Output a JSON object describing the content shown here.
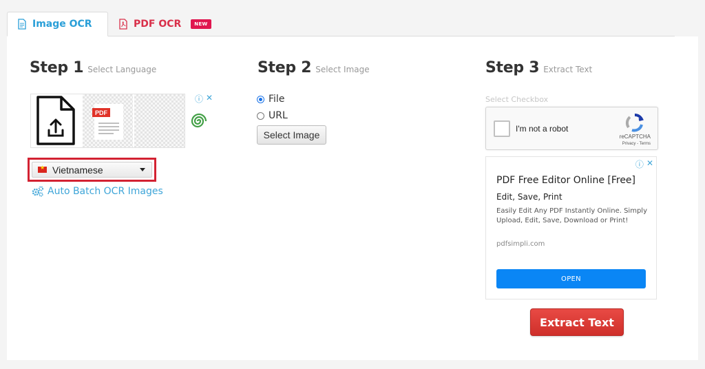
{
  "tabs": [
    {
      "label": "Image OCR",
      "icon": "document-icon",
      "active": true
    },
    {
      "label": "PDF OCR",
      "icon": "pdf-icon",
      "badge": "NEW"
    }
  ],
  "steps": [
    {
      "title": "Step 1",
      "subtitle": "Select Language"
    },
    {
      "title": "Step 2",
      "subtitle": "Select Image"
    },
    {
      "title": "Step 3",
      "subtitle": "Extract Text"
    }
  ],
  "step1": {
    "ad_pdf_label": "PDF",
    "ad_choices": [
      "ⓘ",
      "✕"
    ],
    "language": {
      "selected": "Vietnamese",
      "flag": "vietnam-flag"
    },
    "batch_link": "Auto Batch OCR Images"
  },
  "step2": {
    "options": [
      {
        "label": "File",
        "checked": true
      },
      {
        "label": "URL",
        "checked": false
      }
    ],
    "select_button": "Select Image"
  },
  "step3": {
    "checkbox_label": "Select Checkbox",
    "recaptcha": {
      "text": "I'm not a robot",
      "brand": "reCAPTCHA",
      "links": "Privacy - Terms"
    },
    "ad": {
      "choices": [
        "ⓘ",
        "✕"
      ],
      "title": "PDF Free Editor Online [Free]",
      "subtitle": "Edit, Save, Print",
      "description": "Easily Edit Any PDF Instantly Online. Simply Upload, Edit, Save, Download or Print!",
      "url": "pdfsimpli.com",
      "button": "OPEN"
    },
    "extract_button": "Extract Text"
  },
  "colors": {
    "accent_blue": "#2a9fd8",
    "pdf_red": "#d9304a",
    "extract_red": "#d8392f",
    "ad_button_blue": "#0a86f5",
    "highlight_border": "#d32232"
  }
}
